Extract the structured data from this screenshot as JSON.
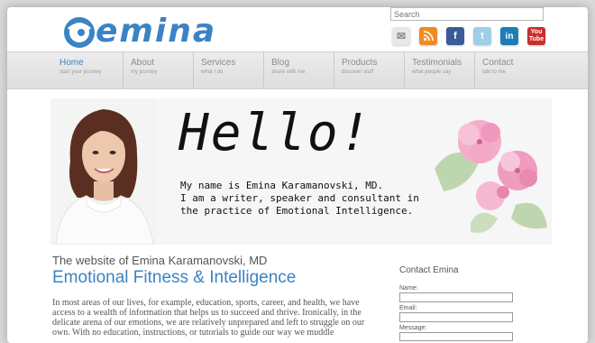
{
  "logo": {
    "text": "emina",
    "color": "#3b83c4"
  },
  "search": {
    "placeholder": "Search"
  },
  "social": [
    "mail-icon",
    "rss-icon",
    "facebook-icon",
    "twitter-icon",
    "linkedin-icon",
    "youtube-icon"
  ],
  "social_text": {
    "facebook": "f",
    "twitter": "t",
    "linkedin": "in",
    "youtube_top": "You",
    "youtube_bottom": "Tube"
  },
  "nav": {
    "items": [
      {
        "label": "Home",
        "sub": "start your journey"
      },
      {
        "label": "About",
        "sub": "my journey"
      },
      {
        "label": "Services",
        "sub": "what I do"
      },
      {
        "label": "Blog",
        "sub": "share with me"
      },
      {
        "label": "Products",
        "sub": "discover stuff"
      },
      {
        "label": "Testimonials",
        "sub": "what people say"
      },
      {
        "label": "Contact",
        "sub": "talk to me"
      }
    ],
    "active": "Home"
  },
  "hero": {
    "hello": "Hello!",
    "lines": [
      "My name is Emina Karamanovski, MD.",
      "I am a writer, speaker and consultant in",
      "the practice of Emotional Intelligence."
    ]
  },
  "main": {
    "site_line": "The website of Emina Karamanovski, MD",
    "title": "Emotional Fitness & Intelligence",
    "paragraph": [
      "In most areas of our lives, for example, education, sports, career, and health, we have",
      "access to a wealth of information that helps us to succeed and thrive. Ironically, in the",
      "delicate arena of our emotions, we are relatively unprepared and left to struggle on our",
      "own. With no education, instructions, or tutorials to guide our way we muddle"
    ]
  },
  "contact": {
    "title": "Contact Emina",
    "name_label": "Name:",
    "email_label": "Email:",
    "message_label": "Message:"
  }
}
